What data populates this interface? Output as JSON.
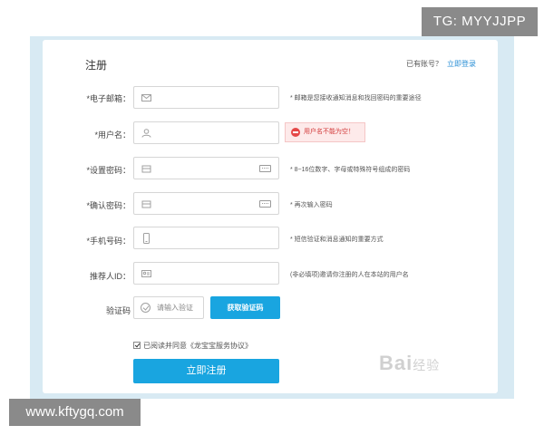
{
  "watermark_top": "TG: MYYJJPP",
  "watermark_bottom": "www.kftygq.com",
  "header": {
    "title": "注册",
    "have_account": "已有账号？",
    "login_link": "立即登录"
  },
  "form": {
    "email": {
      "label": "*电子邮箱：",
      "hint": "* 邮箱是您接收通知消息和找回密码的重要途径"
    },
    "username": {
      "label": "*用户名：",
      "error": "用户名不能为空！"
    },
    "password": {
      "label": "*设置密码：",
      "hint": "* 8~16位数字、字母或特殊符号组成的密码"
    },
    "confirm": {
      "label": "*确认密码：",
      "hint": "* 再次输入密码"
    },
    "phone": {
      "label": "*手机号码：",
      "hint": "* 短信验证和消息通知的重要方式"
    },
    "referrer": {
      "label": "推荐人ID：",
      "hint": "(非必填项)邀请你注册的人在本站的用户名"
    },
    "captcha": {
      "label": "验证码",
      "placeholder": "请输入验证",
      "button": "获取验证码"
    },
    "agree": {
      "text": "已阅读并同意",
      "link": "《龙宝宝服务协议》"
    },
    "submit": "立即注册"
  },
  "baidu_watermark": "Bai",
  "baidu_watermark_suffix": "经验",
  "colors": {
    "accent": "#19a5e0",
    "error": "#d23a3a",
    "background": "#d8eaf3"
  }
}
